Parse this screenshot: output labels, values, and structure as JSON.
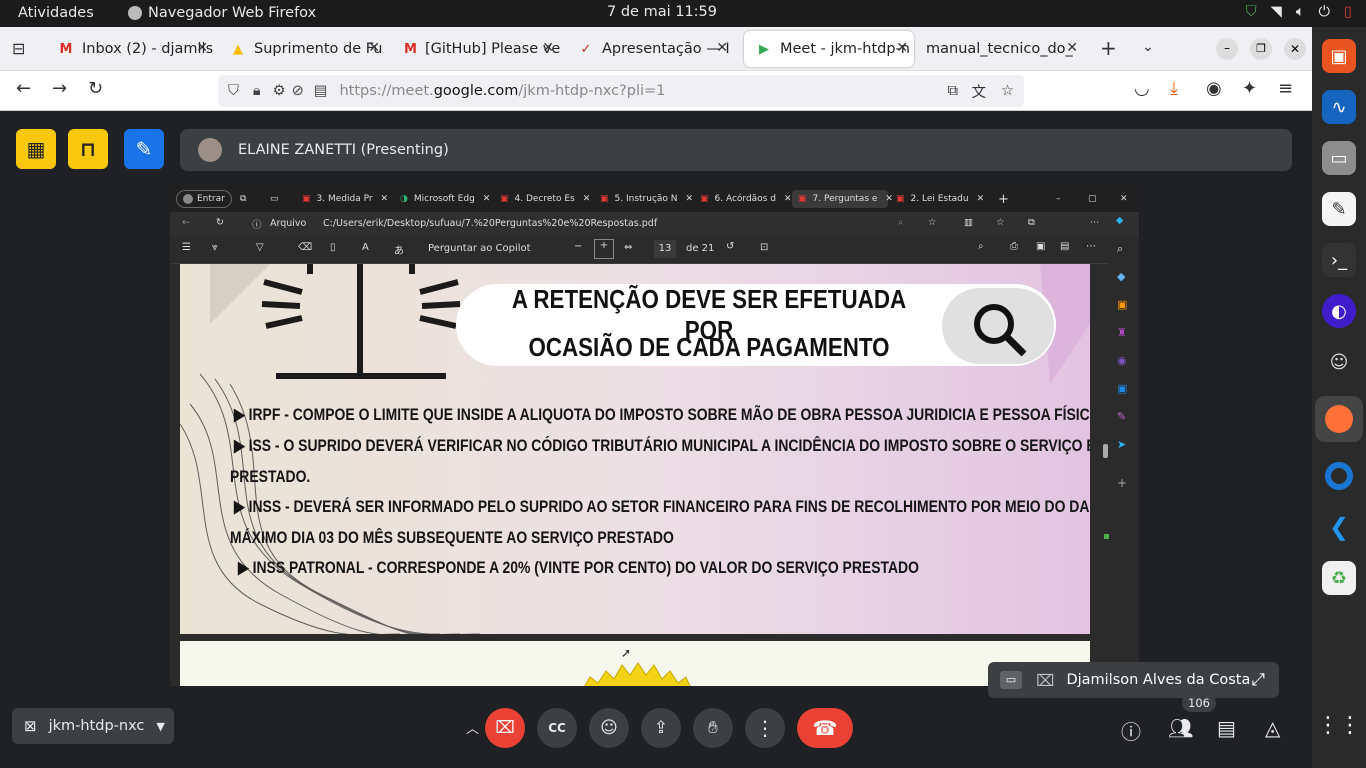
{
  "system": {
    "activities": "Atividades",
    "app_name": "Navegador Web Firefox",
    "clock": "7 de mai  11:59"
  },
  "firefox": {
    "tabs": [
      {
        "label": "Inbox (2) - djamils",
        "icon": "gmail-icon"
      },
      {
        "label": "Suprimento de Fu",
        "icon": "drive-icon"
      },
      {
        "label": "[GitHub] Please ve",
        "icon": "gmail-icon"
      },
      {
        "label": "Apresentação — I",
        "icon": "canva-icon"
      },
      {
        "label": "Meet - jkm-htdp-n",
        "icon": "meet-icon",
        "active": true
      },
      {
        "label": "manual_tecnico_do_",
        "icon": "none"
      }
    ],
    "url_prefix": "https://meet.",
    "url_host": "google.com",
    "url_suffix": "/jkm-htdp-nxc?pli=1"
  },
  "meet": {
    "presenter": "ELAINE ZANETTI (Presenting)",
    "pip_name": "Djamilson Alves da Costa",
    "meeting_code": "jkm-htdp-nxc",
    "participants_count": "106"
  },
  "shared_screen": {
    "edge_profile": "Entrar",
    "tabs": [
      "3. Medida Pr",
      "Microsoft Edg",
      "4. Decreto Es",
      "5. Instrução N",
      "6. Acórdãos d",
      "7. Perguntas e",
      "2. Lei Estadu"
    ],
    "address_label": "Arquivo",
    "address": "C:/Users/erik/Desktop/sufuau/7.%20Perguntas%20e%20Respostas.pdf",
    "copilot": "Perguntar ao Copilot",
    "page_current": "13",
    "page_total": "de 21",
    "slide": {
      "headline_1": "A RETENÇÃO DEVE SER EFETUADA POR",
      "headline_2": "OCASIÃO DE CADA PAGAMENTO",
      "lines": [
        "▶  IRPF - COMPOE O LIMITE QUE INSIDE A ALIQUOTA DO IMPOSTO SOBRE MÃO DE OBRA PESSOA JURIDICIA E PESSOA FÍSICA",
        "▶  ISS  - O SUPRIDO DEVERÁ VERIFICAR NO CÓDIGO TRIBUTÁRIO MUNICIPAL A INCIDÊNCIA DO IMPOSTO SOBRE O SERVIÇO ESPECÍFICO",
        "PRESTADO.",
        "▶  INSS -   DEVERÁ SER INFORMADO PELO SUPRIDO AO SETOR FINANCEIRO PARA FINS DE RECOLHIMENTO POR MEIO DO DARF, NO",
        "MÁXIMO DIA 03 DO MÊS SUBSEQUENTE AO SERVIÇO PRESTADO",
        "▶  INSS PATRONAL - CORRESPONDE A 20% (VINTE POR CENTO) DO VALOR DO SERVIÇO PRESTADO"
      ]
    }
  }
}
